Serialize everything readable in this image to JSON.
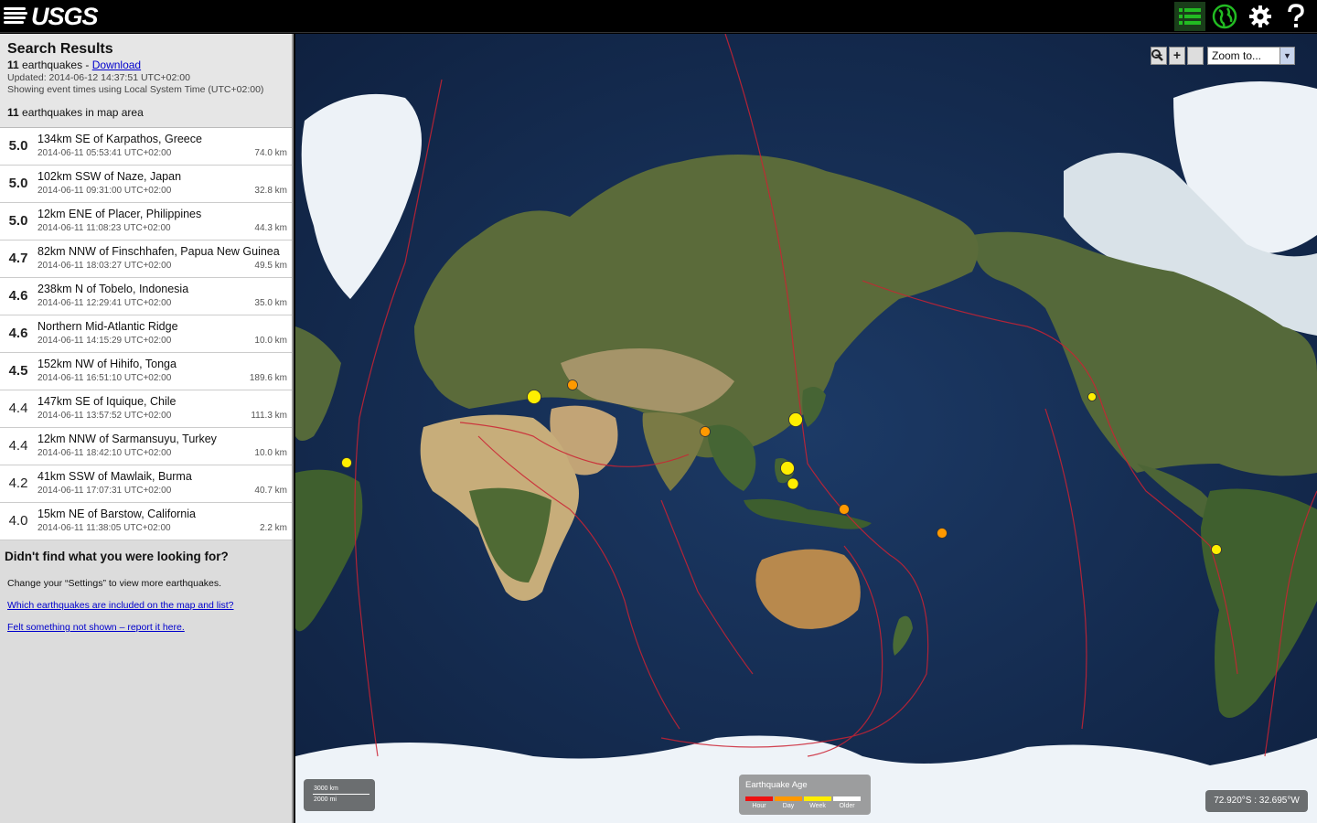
{
  "header": {
    "logo_text": "USGS",
    "buttons": [
      {
        "name": "list-view",
        "icon": "list-icon",
        "color": "#22bb22"
      },
      {
        "name": "map-view",
        "icon": "globe-icon",
        "color": "#22bb22"
      },
      {
        "name": "settings",
        "icon": "gear-icon",
        "color": "#ffffff"
      },
      {
        "name": "help",
        "icon": "question-icon",
        "color": "#ffffff"
      }
    ]
  },
  "sidebar": {
    "title": "Search Results",
    "count": "11",
    "count_label": " earthquakes - ",
    "download_label": "Download",
    "updated": "Updated: 2014-06-12 14:37:51 UTC+02:00",
    "timezone_note": "Showing event times using Local System Time (UTC+02:00)",
    "map_count": "11",
    "map_count_label": " earthquakes in map area",
    "quakes": [
      {
        "mag": "5.0",
        "place": "134km SE of Karpathos, Greece",
        "time": "2014-06-11 05:53:41 UTC+02:00",
        "depth": "74.0 km"
      },
      {
        "mag": "5.0",
        "place": "102km SSW of Naze, Japan",
        "time": "2014-06-11 09:31:00 UTC+02:00",
        "depth": "32.8 km"
      },
      {
        "mag": "5.0",
        "place": "12km ENE of Placer, Philippines",
        "time": "2014-06-11 11:08:23 UTC+02:00",
        "depth": "44.3 km"
      },
      {
        "mag": "4.7",
        "place": "82km NNW of Finschhafen, Papua New Guinea",
        "time": "2014-06-11 18:03:27 UTC+02:00",
        "depth": "49.5 km"
      },
      {
        "mag": "4.6",
        "place": "238km N of Tobelo, Indonesia",
        "time": "2014-06-11 12:29:41 UTC+02:00",
        "depth": "35.0 km"
      },
      {
        "mag": "4.6",
        "place": "Northern Mid-Atlantic Ridge",
        "time": "2014-06-11 14:15:29 UTC+02:00",
        "depth": "10.0 km"
      },
      {
        "mag": "4.5",
        "place": "152km NW of Hihifo, Tonga",
        "time": "2014-06-11 16:51:10 UTC+02:00",
        "depth": "189.6 km"
      },
      {
        "mag": "4.4",
        "place": "147km SE of Iquique, Chile",
        "time": "2014-06-11 13:57:52 UTC+02:00",
        "depth": "111.3 km"
      },
      {
        "mag": "4.4",
        "place": "12km NNW of Sarmansuyu, Turkey",
        "time": "2014-06-11 18:42:10 UTC+02:00",
        "depth": "10.0 km"
      },
      {
        "mag": "4.2",
        "place": "41km SSW of Mawlaik, Burma",
        "time": "2014-06-11 17:07:31 UTC+02:00",
        "depth": "40.7 km"
      },
      {
        "mag": "4.0",
        "place": "15km NE of Barstow, California",
        "time": "2014-06-11 11:38:05 UTC+02:00",
        "depth": "2.2 km"
      }
    ],
    "help": {
      "title": "Didn't find what you were looking for?",
      "settings_note": "Change your “Settings” to view more earthquakes.",
      "link1": "Which earthquakes are included on the map and list?",
      "link2": "Felt something not shown – report it here."
    }
  },
  "map": {
    "zoom_out": "−",
    "zoom_in": "+",
    "zoom_select": "Zoom to...",
    "scale_km": "3000 km",
    "scale_mi": "2000 mi",
    "legend": {
      "title": "Earthquake Age",
      "items": [
        {
          "label": "Hour",
          "color": "#ee1111"
        },
        {
          "label": "Day",
          "color": "#ff9900"
        },
        {
          "label": "Week",
          "color": "#ffee00"
        },
        {
          "label": "Older",
          "color": "#ffffff"
        }
      ]
    },
    "coordinates": "72.920°S : 32.695°W",
    "colors": {
      "ocean": "#162c4e",
      "land": "#5a6b3a",
      "plate_boundary": "#cc2233",
      "recent_day": "#ff9900",
      "recent_week": "#ffee00"
    }
  }
}
